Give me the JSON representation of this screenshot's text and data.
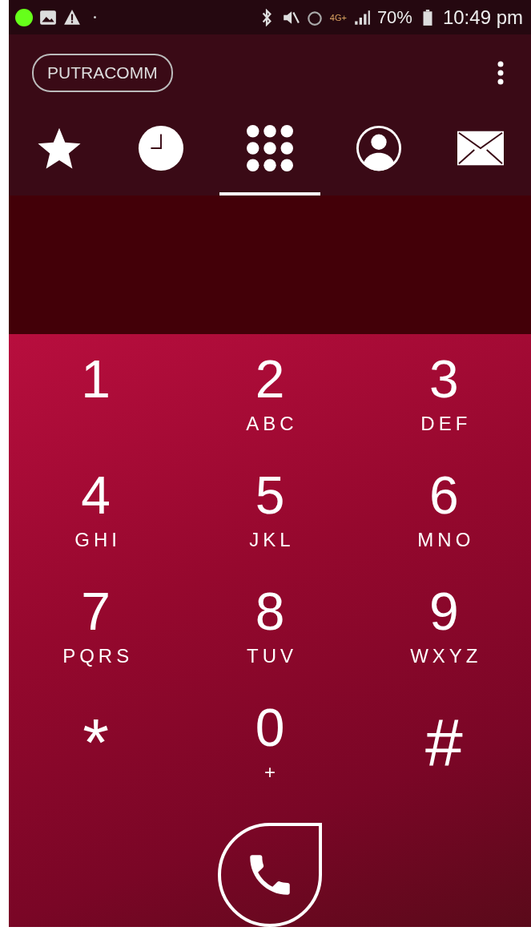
{
  "status_bar": {
    "network": "4G+",
    "battery": "70%",
    "time": "10:49 pm"
  },
  "account_button": "PUTRACOMM",
  "tabs": [
    {
      "kind": "favorites",
      "selected": false
    },
    {
      "kind": "recents",
      "selected": false
    },
    {
      "kind": "dialpad",
      "selected": true
    },
    {
      "kind": "contacts",
      "selected": false
    },
    {
      "kind": "messages",
      "selected": false
    }
  ],
  "keys": [
    {
      "digit": "1"
    },
    {
      "digit": "2",
      "letters": "ABC"
    },
    {
      "digit": "3",
      "letters": "DEF"
    },
    {
      "digit": "4",
      "letters": "GHI"
    },
    {
      "digit": "5",
      "letters": "JKL"
    },
    {
      "digit": "6",
      "letters": "MNO"
    },
    {
      "digit": "7",
      "letters": "PQRS"
    },
    {
      "digit": "8",
      "letters": "TUV"
    },
    {
      "digit": "9",
      "letters": "WXYZ"
    },
    {
      "digit": "*"
    },
    {
      "digit": "0",
      "letters": "+"
    },
    {
      "digit": "#"
    }
  ]
}
